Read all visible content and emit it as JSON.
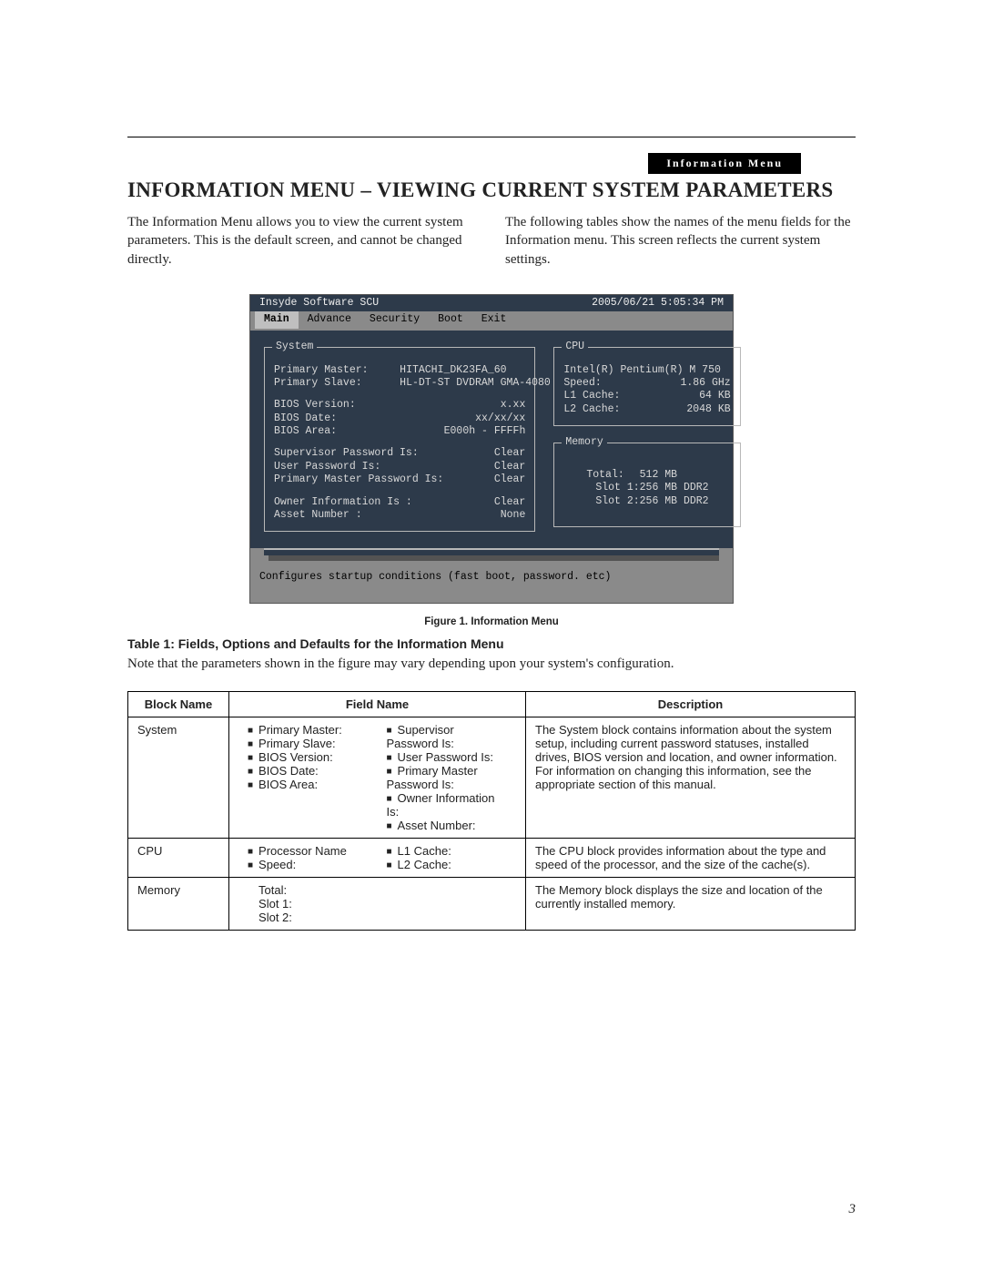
{
  "header_tab": "Information Menu",
  "title": "INFORMATION MENU – VIEWING CURRENT SYSTEM PARAMETERS",
  "intro": {
    "left": "The Information Menu allows you to view the current system parameters. This is the default screen, and cannot be changed directly.",
    "right": "The following tables show the names of the menu fields for the Information menu. This screen reflects the current system settings."
  },
  "bios": {
    "product": "Insyde Software SCU",
    "datetime": "2005/06/21   5:05:34 PM",
    "menu": [
      "Main",
      "Advance",
      "Security",
      "Boot",
      "Exit"
    ],
    "menu_selected": "Main",
    "system_box": "System",
    "cpu_box": "CPU",
    "memory_box": "Memory",
    "system": {
      "primary_master_label": "Primary Master:",
      "primary_master_value": "HITACHI_DK23FA_60",
      "primary_slave_label": "Primary Slave:",
      "primary_slave_value": "HL-DT-ST DVDRAM GMA-4080",
      "bios_version_label": "BIOS Version:",
      "bios_version_value": "x.xx",
      "bios_date_label": "BIOS Date:",
      "bios_date_value": "xx/xx/xx",
      "bios_area_label": "BIOS Area:",
      "bios_area_value": "E000h - FFFFh",
      "supervisor_pw_label": "Supervisor Password Is:",
      "supervisor_pw_value": "Clear",
      "user_pw_label": "User Password Is:",
      "user_pw_value": "Clear",
      "primary_master_pw_label": "Primary Master Password Is:",
      "primary_master_pw_value": "Clear",
      "owner_info_label": "Owner Information Is :",
      "owner_info_value": "Clear",
      "asset_label": "Asset Number :",
      "asset_value": "None"
    },
    "cpu": {
      "name": "Intel(R) Pentium(R)  M 750",
      "speed_label": "Speed:",
      "speed_value": "1.86 GHz",
      "l1_label": "L1 Cache:",
      "l1_value": "64 KB",
      "l2_label": "L2 Cache:",
      "l2_value": "2048 KB"
    },
    "memory": {
      "total_label": "Total:",
      "total_value": "512 MB",
      "slot1_label": "Slot 1:",
      "slot1_value": "256 MB DDR2",
      "slot2_label": "Slot 2:",
      "slot2_value": "256 MB DDR2"
    },
    "help": "Configures startup conditions (fast boot, password. etc)"
  },
  "figure_caption": "Figure 1.  Information Menu",
  "table_title": "Table 1: Fields, Options and Defaults for the Information Menu",
  "table_note": "Note that the parameters shown in the figure may vary depending upon your system's configuration.",
  "table": {
    "headers": {
      "block": "Block Name",
      "field": "Field Name",
      "desc": "Description"
    },
    "rows": [
      {
        "block": "System",
        "fields_col1": [
          "Primary Master:",
          "Primary Slave:",
          "BIOS Version:",
          "BIOS Date:",
          "BIOS Area:"
        ],
        "fields_col2": [
          "Supervisor Password Is:",
          "User Password Is:",
          "Primary Master Password Is:",
          "Owner Information Is:",
          "Asset Number:"
        ],
        "desc": "The System block contains information about the system setup, including current password statuses, installed drives, BIOS version and location, and owner information. For information on changing this information, see the appropriate section of this manual."
      },
      {
        "block": "CPU",
        "fields_col1": [
          "Processor Name",
          "Speed:"
        ],
        "fields_col2": [
          "L1 Cache:",
          "L2 Cache:"
        ],
        "desc": "The CPU block provides information about the type and speed of the processor, and the size of the cache(s)."
      },
      {
        "block": "Memory",
        "fields_col1_plain": [
          "Total:",
          "Slot 1:",
          "Slot 2:"
        ],
        "desc": "The Memory block displays the size and location of the currently installed memory."
      }
    ]
  },
  "page_number": "3"
}
